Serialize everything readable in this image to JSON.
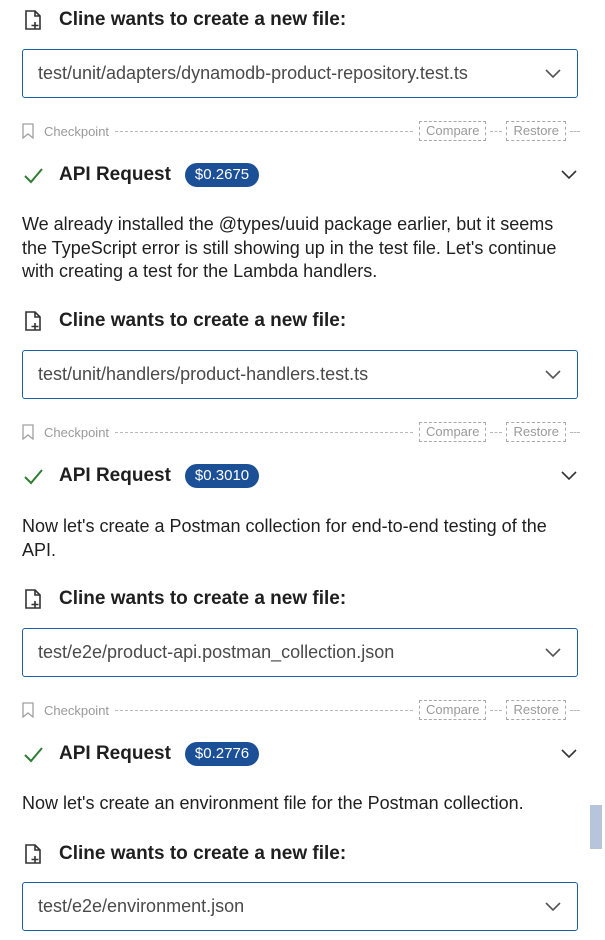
{
  "colors": {
    "accent_border": "#1c5ea8",
    "cost_badge_bg": "#1b4f96",
    "check_green": "#2e7d32",
    "muted_text": "#9a9a9a"
  },
  "icons": {
    "new_file": "file-plus-icon",
    "checkpoint": "bookmark-icon",
    "api_done": "check-icon",
    "expand": "chevron-down-icon"
  },
  "file_requests": [
    {
      "title": "Cline wants to create a new file:",
      "path": "test/unit/adapters/dynamodb-product-repository.test.ts"
    },
    {
      "title": "Cline wants to create a new file:",
      "path": "test/unit/handlers/product-handlers.test.ts"
    },
    {
      "title": "Cline wants to create a new file:",
      "path": "test/e2e/product-api.postman_collection.json"
    },
    {
      "title": "Cline wants to create a new file:",
      "path": "test/e2e/environment.json"
    }
  ],
  "checkpoints": [
    {
      "label": "Checkpoint",
      "compare": "Compare",
      "restore": "Restore"
    },
    {
      "label": "Checkpoint",
      "compare": "Compare",
      "restore": "Restore"
    },
    {
      "label": "Checkpoint",
      "compare": "Compare",
      "restore": "Restore"
    }
  ],
  "api_requests": [
    {
      "label": "API Request",
      "cost": "$0.2675"
    },
    {
      "label": "API Request",
      "cost": "$0.3010"
    },
    {
      "label": "API Request",
      "cost": "$0.2776"
    }
  ],
  "messages": [
    "We already installed the @types/uuid package earlier, but it seems the TypeScript error is still showing up in the test file. Let's continue with creating a test for the Lambda handlers.",
    "Now let's create a Postman collection for end-to-end testing of the API.",
    "Now let's create an environment file for the Postman collection."
  ]
}
